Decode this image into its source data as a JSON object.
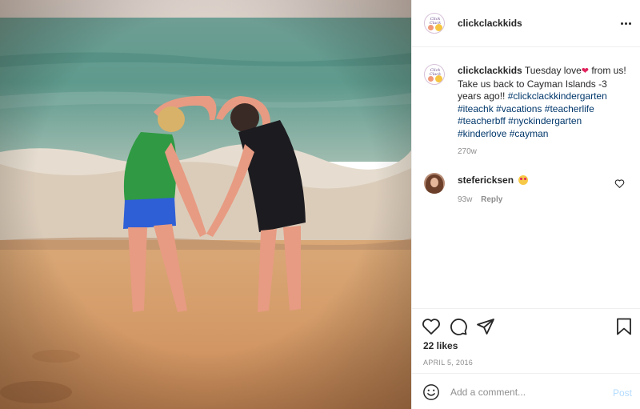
{
  "post": {
    "username": "clickclackkids",
    "more_label": "More options"
  },
  "caption": {
    "username": "clickclackkids",
    "text_before_emoji": "Tuesday love",
    "heart_emoji": "❤",
    "text_after_emoji": " from us! Take us back to Cayman Islands -3 years ago!!",
    "hashtags": [
      "#clickclackkindergarten",
      "#iteachk",
      "#vacations",
      "#teacherlife",
      "#teacherbff",
      "#nyckindergarten",
      "#kinderlove",
      "#cayman"
    ],
    "time": "270w"
  },
  "comment": {
    "username": "stefericksen",
    "emoji": "heart-eyes-emoji",
    "time": "93w",
    "reply_label": "Reply"
  },
  "actions": {
    "likes": "22 likes",
    "date": "APRIL 5, 2016"
  },
  "add_comment": {
    "placeholder": "Add a comment...",
    "post_label": "Post"
  },
  "colors": {
    "hashtag": "#00376b",
    "muted": "#8e8e8e",
    "post_button": "#b3dbff",
    "heart": "#e0245e"
  },
  "icons": [
    "more-icon",
    "heart-icon",
    "comment-icon",
    "share-icon",
    "bookmark-icon",
    "smile-icon"
  ]
}
